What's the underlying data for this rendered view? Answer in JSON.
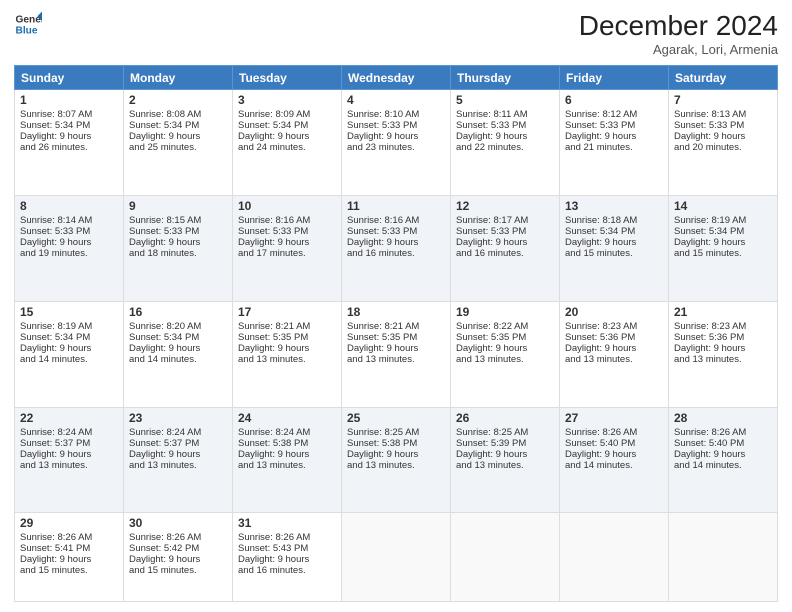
{
  "logo": {
    "line1": "General",
    "line2": "Blue"
  },
  "title": "December 2024",
  "location": "Agarak, Lori, Armenia",
  "weekdays": [
    "Sunday",
    "Monday",
    "Tuesday",
    "Wednesday",
    "Thursday",
    "Friday",
    "Saturday"
  ],
  "weeks": [
    [
      {
        "day": "1",
        "lines": [
          "Sunrise: 8:07 AM",
          "Sunset: 5:34 PM",
          "Daylight: 9 hours",
          "and 26 minutes."
        ]
      },
      {
        "day": "2",
        "lines": [
          "Sunrise: 8:08 AM",
          "Sunset: 5:34 PM",
          "Daylight: 9 hours",
          "and 25 minutes."
        ]
      },
      {
        "day": "3",
        "lines": [
          "Sunrise: 8:09 AM",
          "Sunset: 5:34 PM",
          "Daylight: 9 hours",
          "and 24 minutes."
        ]
      },
      {
        "day": "4",
        "lines": [
          "Sunrise: 8:10 AM",
          "Sunset: 5:33 PM",
          "Daylight: 9 hours",
          "and 23 minutes."
        ]
      },
      {
        "day": "5",
        "lines": [
          "Sunrise: 8:11 AM",
          "Sunset: 5:33 PM",
          "Daylight: 9 hours",
          "and 22 minutes."
        ]
      },
      {
        "day": "6",
        "lines": [
          "Sunrise: 8:12 AM",
          "Sunset: 5:33 PM",
          "Daylight: 9 hours",
          "and 21 minutes."
        ]
      },
      {
        "day": "7",
        "lines": [
          "Sunrise: 8:13 AM",
          "Sunset: 5:33 PM",
          "Daylight: 9 hours",
          "and 20 minutes."
        ]
      }
    ],
    [
      {
        "day": "8",
        "lines": [
          "Sunrise: 8:14 AM",
          "Sunset: 5:33 PM",
          "Daylight: 9 hours",
          "and 19 minutes."
        ]
      },
      {
        "day": "9",
        "lines": [
          "Sunrise: 8:15 AM",
          "Sunset: 5:33 PM",
          "Daylight: 9 hours",
          "and 18 minutes."
        ]
      },
      {
        "day": "10",
        "lines": [
          "Sunrise: 8:16 AM",
          "Sunset: 5:33 PM",
          "Daylight: 9 hours",
          "and 17 minutes."
        ]
      },
      {
        "day": "11",
        "lines": [
          "Sunrise: 8:16 AM",
          "Sunset: 5:33 PM",
          "Daylight: 9 hours",
          "and 16 minutes."
        ]
      },
      {
        "day": "12",
        "lines": [
          "Sunrise: 8:17 AM",
          "Sunset: 5:33 PM",
          "Daylight: 9 hours",
          "and 16 minutes."
        ]
      },
      {
        "day": "13",
        "lines": [
          "Sunrise: 8:18 AM",
          "Sunset: 5:34 PM",
          "Daylight: 9 hours",
          "and 15 minutes."
        ]
      },
      {
        "day": "14",
        "lines": [
          "Sunrise: 8:19 AM",
          "Sunset: 5:34 PM",
          "Daylight: 9 hours",
          "and 15 minutes."
        ]
      }
    ],
    [
      {
        "day": "15",
        "lines": [
          "Sunrise: 8:19 AM",
          "Sunset: 5:34 PM",
          "Daylight: 9 hours",
          "and 14 minutes."
        ]
      },
      {
        "day": "16",
        "lines": [
          "Sunrise: 8:20 AM",
          "Sunset: 5:34 PM",
          "Daylight: 9 hours",
          "and 14 minutes."
        ]
      },
      {
        "day": "17",
        "lines": [
          "Sunrise: 8:21 AM",
          "Sunset: 5:35 PM",
          "Daylight: 9 hours",
          "and 13 minutes."
        ]
      },
      {
        "day": "18",
        "lines": [
          "Sunrise: 8:21 AM",
          "Sunset: 5:35 PM",
          "Daylight: 9 hours",
          "and 13 minutes."
        ]
      },
      {
        "day": "19",
        "lines": [
          "Sunrise: 8:22 AM",
          "Sunset: 5:35 PM",
          "Daylight: 9 hours",
          "and 13 minutes."
        ]
      },
      {
        "day": "20",
        "lines": [
          "Sunrise: 8:23 AM",
          "Sunset: 5:36 PM",
          "Daylight: 9 hours",
          "and 13 minutes."
        ]
      },
      {
        "day": "21",
        "lines": [
          "Sunrise: 8:23 AM",
          "Sunset: 5:36 PM",
          "Daylight: 9 hours",
          "and 13 minutes."
        ]
      }
    ],
    [
      {
        "day": "22",
        "lines": [
          "Sunrise: 8:24 AM",
          "Sunset: 5:37 PM",
          "Daylight: 9 hours",
          "and 13 minutes."
        ]
      },
      {
        "day": "23",
        "lines": [
          "Sunrise: 8:24 AM",
          "Sunset: 5:37 PM",
          "Daylight: 9 hours",
          "and 13 minutes."
        ]
      },
      {
        "day": "24",
        "lines": [
          "Sunrise: 8:24 AM",
          "Sunset: 5:38 PM",
          "Daylight: 9 hours",
          "and 13 minutes."
        ]
      },
      {
        "day": "25",
        "lines": [
          "Sunrise: 8:25 AM",
          "Sunset: 5:38 PM",
          "Daylight: 9 hours",
          "and 13 minutes."
        ]
      },
      {
        "day": "26",
        "lines": [
          "Sunrise: 8:25 AM",
          "Sunset: 5:39 PM",
          "Daylight: 9 hours",
          "and 13 minutes."
        ]
      },
      {
        "day": "27",
        "lines": [
          "Sunrise: 8:26 AM",
          "Sunset: 5:40 PM",
          "Daylight: 9 hours",
          "and 14 minutes."
        ]
      },
      {
        "day": "28",
        "lines": [
          "Sunrise: 8:26 AM",
          "Sunset: 5:40 PM",
          "Daylight: 9 hours",
          "and 14 minutes."
        ]
      }
    ],
    [
      {
        "day": "29",
        "lines": [
          "Sunrise: 8:26 AM",
          "Sunset: 5:41 PM",
          "Daylight: 9 hours",
          "and 15 minutes."
        ]
      },
      {
        "day": "30",
        "lines": [
          "Sunrise: 8:26 AM",
          "Sunset: 5:42 PM",
          "Daylight: 9 hours",
          "and 15 minutes."
        ]
      },
      {
        "day": "31",
        "lines": [
          "Sunrise: 8:26 AM",
          "Sunset: 5:43 PM",
          "Daylight: 9 hours",
          "and 16 minutes."
        ]
      },
      null,
      null,
      null,
      null
    ]
  ]
}
